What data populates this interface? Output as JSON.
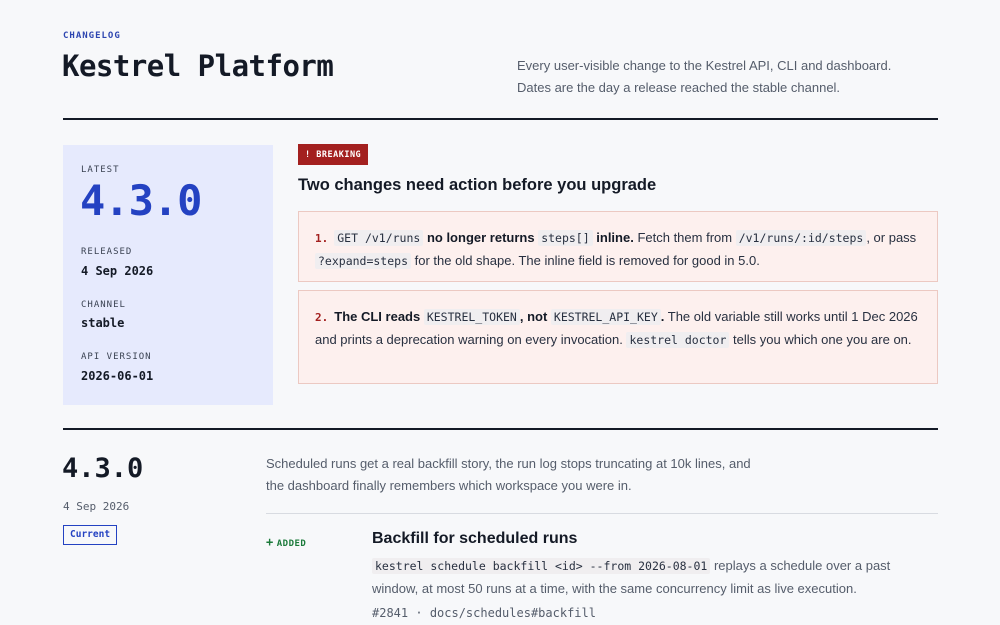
{
  "header": {
    "eyebrow": "CHANGELOG",
    "title": "Kestrel Platform",
    "intro_line1": "Every user-visible change to the Kestrel API, CLI and dashboard.",
    "intro_line2": "Dates are the day a release reached the stable channel."
  },
  "latest": {
    "label": "LATEST",
    "version": "4.3.0",
    "released_label": "RELEASED",
    "released": "4 Sep 2026",
    "channel_label": "CHANNEL",
    "channel": "stable",
    "api_version_label": "API VERSION",
    "api_version": "2026-06-01"
  },
  "breaking": {
    "badge": "! BREAKING",
    "heading": "Two changes need action before you upgrade",
    "items": [
      {
        "num": "1.",
        "code_a": "GET /v1/runs",
        "bold_a": " no longer returns ",
        "code_b": "steps[]",
        "bold_b": " inline.",
        "text_a": " Fetch them from ",
        "code_c": "/v1/runs/:id/steps",
        "text_b": ", or pass ",
        "code_d": "?expand=steps",
        "text_c": " for the old shape. The inline field is removed for good in 5.0."
      },
      {
        "num": "2.",
        "bold_a": "The CLI reads ",
        "code_a": "KESTREL_TOKEN",
        "bold_b": ", not ",
        "code_b": "KESTREL_API_KEY",
        "bold_c": ".",
        "text_a": " The old variable still works until 1 Dec 2026 and prints a deprecation warning on every invocation. ",
        "code_c": "kestrel doctor",
        "text_b": " tells you which one you are on."
      }
    ]
  },
  "release": {
    "version": "4.3.0",
    "date": "4 Sep 2026",
    "tag": "Current",
    "summary_line1": "Scheduled runs get a real backfill story, the run log stops truncating at 10k lines, and",
    "summary_line2": "the dashboard finally remembers which workspace you were in.",
    "changes": [
      {
        "type_plus": "+",
        "type": "ADDED",
        "title": "Backfill for scheduled runs",
        "code": "kestrel schedule backfill <id> --from 2026-08-01",
        "desc": " replays a schedule over a past window, at most 50 runs at a time, with the same concurrency limit as live execution.",
        "ref_issue": "#2841",
        "ref_sep": " · ",
        "ref_doc": "docs/schedules#backfill"
      }
    ]
  }
}
